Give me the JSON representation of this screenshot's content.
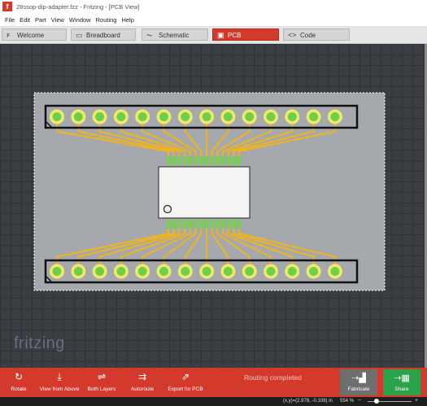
{
  "window": {
    "title": "28ssop-dip-adapter.fzz - Fritzing - [PCB View]",
    "app_icon": "fritzing-f-icon"
  },
  "menu": [
    "File",
    "Edit",
    "Part",
    "View",
    "Window",
    "Routing",
    "Help"
  ],
  "tabs": [
    {
      "label": "Welcome",
      "icon": "f-icon",
      "active": false
    },
    {
      "label": "Breadboard",
      "icon": "breadboard-icon",
      "active": false
    },
    {
      "label": "Schematic",
      "icon": "schematic-icon",
      "active": false
    },
    {
      "label": "PCB",
      "icon": "pcb-icon",
      "active": true
    },
    {
      "label": "Code",
      "icon": "code-icon",
      "active": false
    }
  ],
  "canvas": {
    "logo": "fritzing",
    "pins_per_row": 14,
    "colors": {
      "board": "#a5a8ad",
      "pad_ring": "#f2e96a",
      "pad_center": "#6ed04a",
      "trace": "#f0b51c",
      "ssop_pad": "#74d444",
      "chip_body": "#f4f4f4",
      "background": "#3b3e43"
    }
  },
  "toolbar": {
    "buttons": [
      {
        "label": "Rotate",
        "icon": "rotate-icon"
      },
      {
        "label": "View from Above",
        "icon": "view-from-above-icon"
      },
      {
        "label": "Both Layers",
        "icon": "both-layers-icon"
      },
      {
        "label": "Autoroute",
        "icon": "autoroute-icon"
      },
      {
        "label": "Export for PCB",
        "icon": "export-icon"
      }
    ],
    "status": "Routing completed",
    "fabricate": "Fabricate",
    "share": "Share"
  },
  "statusbar": {
    "coords": "(x,y)=(2.978, -0.108) in",
    "zoom": "554 %"
  }
}
